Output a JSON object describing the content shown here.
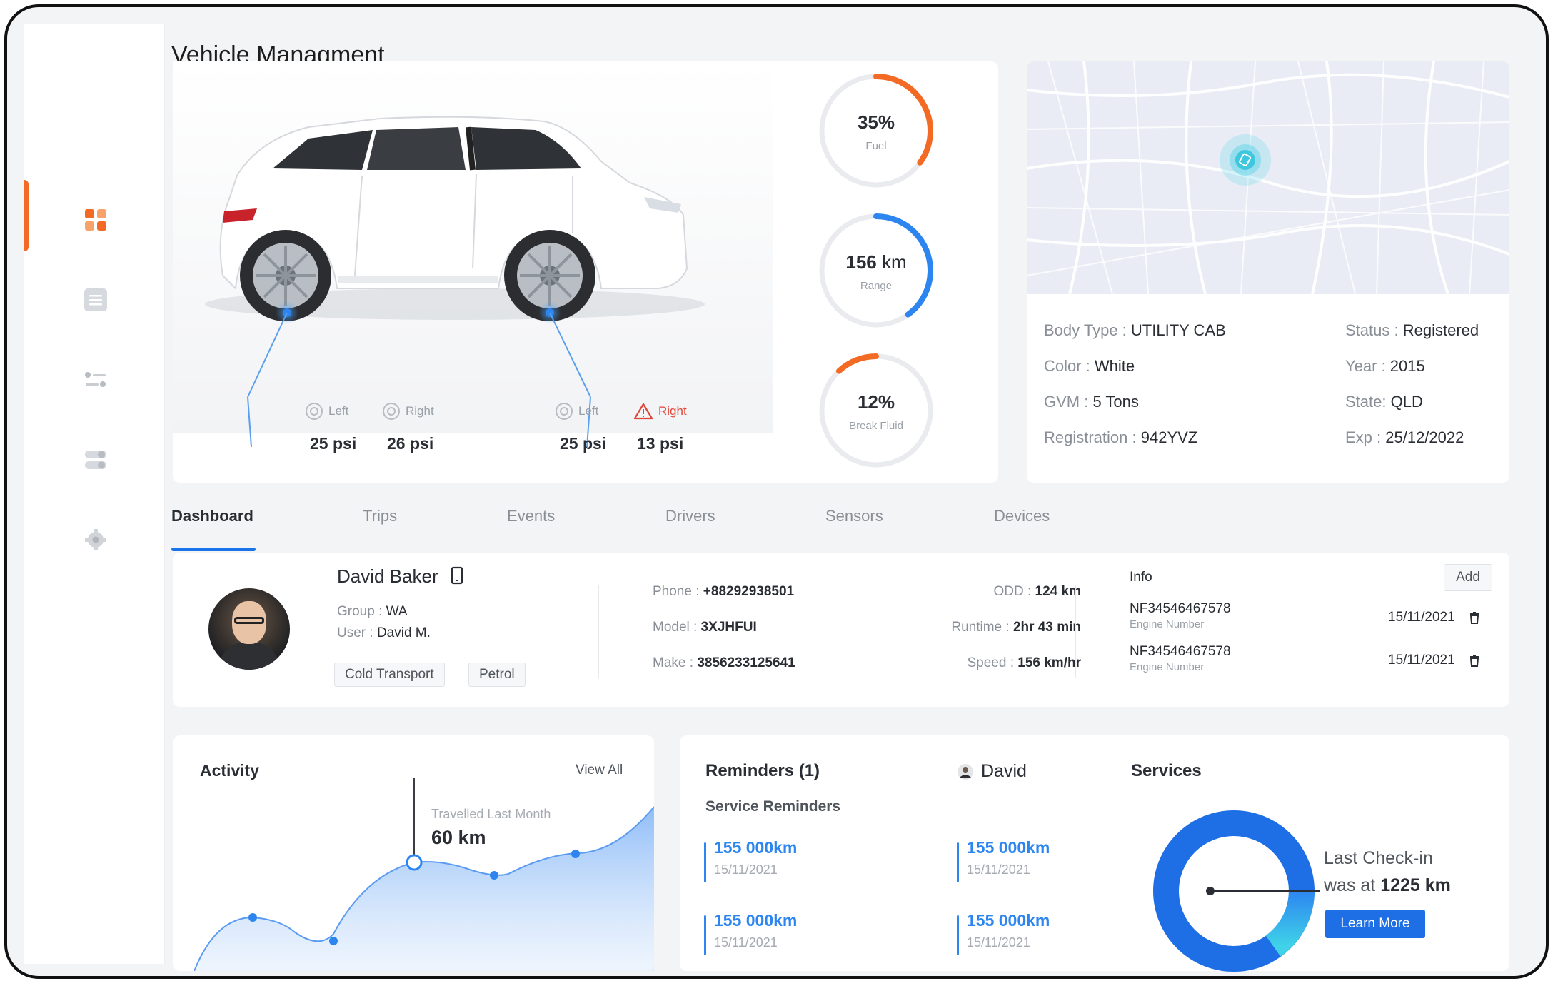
{
  "app": {
    "title": "Vehicle Managment"
  },
  "sidebar": {
    "items": [
      {
        "icon": "dashboard-grid-icon",
        "active": true
      },
      {
        "icon": "list-icon",
        "active": false
      },
      {
        "icon": "sliders-icon",
        "active": false
      },
      {
        "icon": "toggles-icon",
        "active": false
      },
      {
        "icon": "settings-icon",
        "active": false
      }
    ],
    "accent_color": "#f26a24"
  },
  "tires": [
    {
      "side": "Left",
      "pressure": "25 psi",
      "warning": false
    },
    {
      "side": "Right",
      "pressure": "26 psi",
      "warning": false
    },
    {
      "side": "Left",
      "pressure": "25 psi",
      "warning": false
    },
    {
      "side": "Right",
      "pressure": "13 psi",
      "warning": true
    }
  ],
  "gauges": [
    {
      "value": "35%",
      "unit": "",
      "label": "Fuel",
      "percent": 35,
      "color": "#f26a24"
    },
    {
      "value": "156",
      "unit": " km",
      "label": "Range",
      "percent": 40,
      "color": "#2d86f0"
    },
    {
      "value": "12%",
      "unit": "",
      "label": "Break Fluid",
      "percent": 12,
      "color": "#f26a24"
    }
  ],
  "vehicle_specs": {
    "body_type": {
      "label": "Body Type : ",
      "value": "UTILITY CAB"
    },
    "color": {
      "label": "Color : ",
      "value": "White"
    },
    "gvm": {
      "label": "GVM : ",
      "value": "5 Tons"
    },
    "registration": {
      "label": "Registration : ",
      "value": "942YVZ"
    },
    "status": {
      "label": "Status : ",
      "value": "Registered"
    },
    "year": {
      "label": "Year : ",
      "value": "2015"
    },
    "state": {
      "label": "State: ",
      "value": "QLD"
    },
    "exp": {
      "label": "Exp : ",
      "value": "25/12/2022"
    }
  },
  "tabs": [
    "Dashboard",
    "Trips",
    "Events",
    "Drivers",
    "Sensors",
    "Devices"
  ],
  "driver": {
    "name": "David Baker",
    "group_label": "Group : ",
    "group": "WA",
    "user_label": "User : ",
    "user": "David M.",
    "tags": [
      "Cold Transport",
      "Petrol"
    ],
    "phone_label": "Phone : ",
    "phone": "+88292938501",
    "model_label": "Model : ",
    "model": "3XJHFUI",
    "make_label": "Make : ",
    "make": "3856233125641",
    "odd_label": "ODD : ",
    "odd": "124 km",
    "runtime_label": "Runtime : ",
    "runtime": "2hr 43 min",
    "speed_label": "Speed : ",
    "speed": "156 km/hr"
  },
  "info": {
    "title": "Info",
    "add_label": "Add",
    "engines": [
      {
        "number": "NF34546467578",
        "sub": "Engine Number",
        "date": "15/11/2021"
      },
      {
        "number": "NF34546467578",
        "sub": "Engine Number",
        "date": "15/11/2021"
      }
    ]
  },
  "activity": {
    "title": "Activity",
    "view_all": "View All",
    "tooltip_label": "Travelled Last Month",
    "tooltip_value": "60 km"
  },
  "reminders": {
    "title": "Reminders (1)",
    "user": "David",
    "subtitle": "Service Reminders",
    "items": [
      {
        "value": "155 000km",
        "date": "15/11/2021"
      },
      {
        "value": "155 000km",
        "date": "15/11/2021"
      },
      {
        "value": "155 000km",
        "date": "15/11/2021"
      },
      {
        "value": "155 000km",
        "date": "15/11/2021"
      }
    ]
  },
  "services": {
    "title": "Services",
    "line1": "Last Check-in",
    "line2_prefix": "was at ",
    "line2_value": "1225 km",
    "button": "Learn More"
  }
}
